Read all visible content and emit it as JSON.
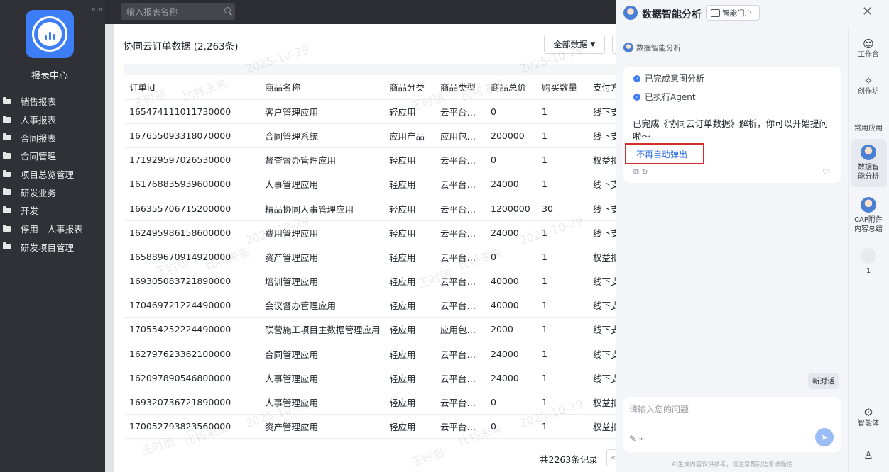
{
  "sidebar": {
    "title": "报表中心",
    "collapse_icon": "«|»",
    "items": [
      {
        "label": "销售报表"
      },
      {
        "label": "人事报表"
      },
      {
        "label": "合同报表"
      },
      {
        "label": "合同管理"
      },
      {
        "label": "项目总览管理"
      },
      {
        "label": "研发业务"
      },
      {
        "label": "开发"
      },
      {
        "label": "停用—人事报表"
      },
      {
        "label": "研发项目管理"
      }
    ]
  },
  "topbar": {
    "search_placeholder": "输入报表名称"
  },
  "report": {
    "title": "协同云订单数据 (2,263条)",
    "filter_label": "全部数据",
    "columns": [
      "订单id",
      "商品名称",
      "商品分类",
      "商品类型",
      "商品总价",
      "购买数量",
      "支付方"
    ],
    "rows": [
      [
        "165474111011730000",
        "客户管理应用",
        "轻应用",
        "云平台…",
        "0",
        "1",
        "线下支"
      ],
      [
        "167655093318070000",
        "合同管理系统",
        "应用产品",
        "应用包…",
        "200000",
        "1",
        "线下支"
      ],
      [
        "171929597026530000",
        "督查督办管理应用",
        "轻应用",
        "云平台…",
        "0",
        "1",
        "权益扣"
      ],
      [
        "161768835939600000",
        "人事管理应用",
        "轻应用",
        "云平台…",
        "24000",
        "1",
        "线下支"
      ],
      [
        "166355706715200000",
        "精品协同人事管理应用",
        "轻应用",
        "云平台…",
        "1200000",
        "30",
        "线下支"
      ],
      [
        "162495986158600000",
        "费用管理应用",
        "轻应用",
        "云平台…",
        "24000",
        "1",
        "线下支"
      ],
      [
        "165889670914920000",
        "资产管理应用",
        "轻应用",
        "云平台…",
        "0",
        "1",
        "权益扣"
      ],
      [
        "169305083721890000",
        "培训管理应用",
        "轻应用",
        "云平台…",
        "40000",
        "1",
        "线下支"
      ],
      [
        "170469721224490000",
        "会议督办管理应用",
        "轻应用",
        "云平台…",
        "40000",
        "1",
        "线下支"
      ],
      [
        "170554252224490000",
        "联营施工项目主数据管理应用",
        "轻应用",
        "应用包…",
        "2000",
        "1",
        "线下支"
      ],
      [
        "162797623362100000",
        "合同管理应用",
        "轻应用",
        "云平台…",
        "24000",
        "1",
        "线下支"
      ],
      [
        "162097890546800000",
        "人事管理应用",
        "轻应用",
        "云平台…",
        "24000",
        "1",
        "线下支"
      ],
      [
        "169320736721890000",
        "人事管理应用",
        "轻应用",
        "云平台…",
        "0",
        "1",
        "权益扣"
      ],
      [
        "170052793823560000",
        "资产管理应用",
        "轻应用",
        "云平台…",
        "0",
        "1",
        "权益扣"
      ]
    ],
    "total_label": "共2263条记录",
    "prev_icon": "<"
  },
  "watermarks": [
    "王时丽",
    "比特未来",
    "2025-10-29"
  ],
  "panel": {
    "title": "数据智能分析",
    "portal_label": "智能门户",
    "close_icon": "✕",
    "sender": "数据智能分析",
    "steps": [
      "已完成意图分析",
      "已执行Agent"
    ],
    "message": "已完成《协同云订单数据》解析，你可以开始提问啦～",
    "no_popup_label": "不再自动弹出",
    "actions_icons": "⧉  ↻",
    "thumb_icon": "♡",
    "new_chat_label": "新对话",
    "input_placeholder": "请输入您的问题",
    "input_tools": "✎  ⌁",
    "send_icon": "➤",
    "disclaimer": "AI生成内容仅供参考，请注意甄别信息准确性",
    "rail": {
      "workbench": "工作台",
      "workshop": "创作坊",
      "common_apps": "常用应用",
      "data_analysis": "数据智能分析",
      "cap_summary": "CAP附件内容总结",
      "count": "1",
      "agent": "智能体"
    }
  }
}
